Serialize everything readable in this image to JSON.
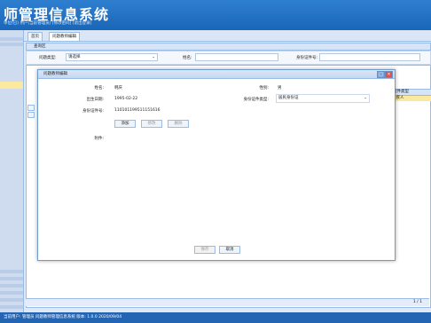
{
  "header": {
    "title": "师管理信息系统",
    "user_info": "单位(已)  用户(当前管理员)  [修改密码]  [退出登录]"
  },
  "tabs": [
    "首页",
    "问题教师编辑"
  ],
  "query": {
    "panel_title": "查询区",
    "type_label": "问题类型:",
    "type_value": "请选择",
    "name_label": "姓名:",
    "id_label": "身份证件号:"
  },
  "grid": {
    "header_right": "证件类型",
    "selected_row": "残疾人"
  },
  "modal": {
    "title": "问题教师编辑",
    "name_label": "姓名:",
    "name_value": "韩庆",
    "gender_label": "性别:",
    "gender_value": "男",
    "birth_label": "出生日期:",
    "birth_value": "1995-02-22",
    "id_type_label": "身份证件类型:",
    "id_type_value": "居民身份证",
    "id_no_label": "身份证件号:",
    "id_no_value": "110101199511151616",
    "add_label": "添加",
    "edit_label": "修改",
    "delete_label": "删除",
    "attachment_label": "附件:",
    "save_label": "保存",
    "close_label": "取消"
  },
  "pager": {
    "text": "1 / 1"
  },
  "footer": {
    "text": "当前用户: 管理员    问题教师管理信息系统  版本: 1.0.0 2020/09/04"
  }
}
